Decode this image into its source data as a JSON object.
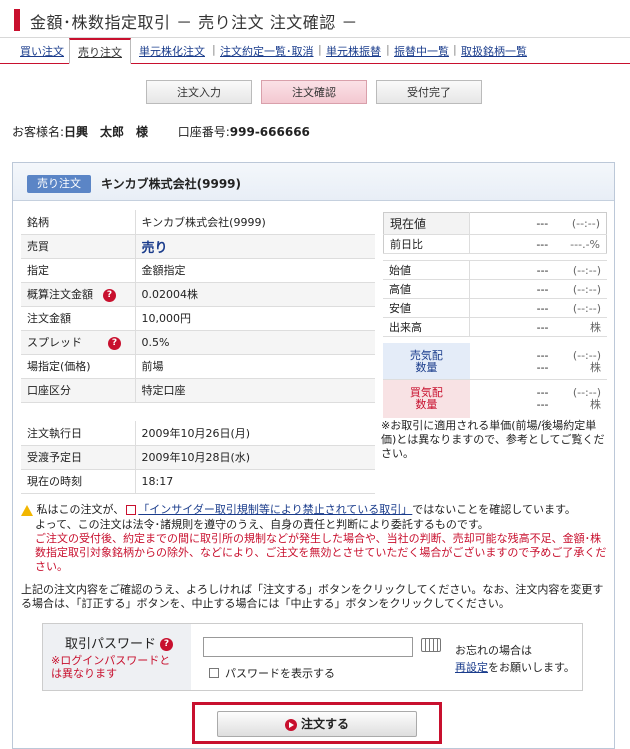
{
  "header": {
    "title": "金額･株数指定取引 － 売り注文 注文確認 －"
  },
  "tabs": [
    {
      "label": "買い注文"
    },
    {
      "label": "売り注文",
      "active": true
    },
    {
      "label": "単元株化注文"
    },
    {
      "label": "注文約定一覧･取消"
    },
    {
      "label": "単元株振替"
    },
    {
      "label": "振替中一覧"
    },
    {
      "label": "取扱銘柄一覧"
    }
  ],
  "steps": [
    {
      "label": "注文入力"
    },
    {
      "label": "注文確認",
      "active": true
    },
    {
      "label": "受付完了"
    }
  ],
  "customer": {
    "name_label": "お客様名:",
    "name": "日興　太郎　様",
    "account_label": "口座番号:",
    "account": "999-666666"
  },
  "panel": {
    "badge": "売り注文",
    "stock": "キンカブ株式会社(9999)"
  },
  "order_rows": [
    {
      "key": "銘柄",
      "value": "キンカブ株式会社(9999)"
    },
    {
      "key": "売買",
      "value": "売り"
    },
    {
      "key": "指定",
      "value": "金額指定"
    },
    {
      "key": "概算注文金額",
      "value": "0.02004株"
    },
    {
      "key": "注文金額",
      "value": "10,000円"
    },
    {
      "key": "スプレッド",
      "value": "0.5%"
    },
    {
      "key": "場指定(価格)",
      "value": "前場"
    },
    {
      "key": "口座区分",
      "value": "特定口座"
    }
  ],
  "date_rows": [
    {
      "key": "注文執行日",
      "value": "2009年10月26日(月)"
    },
    {
      "key": "受渡予定日",
      "value": "2009年10月28日(水)"
    },
    {
      "key": "現在の時刻",
      "value": "18:17"
    }
  ],
  "quote_top": [
    {
      "label": "現在値",
      "value": "---",
      "sub": "(--:--)"
    },
    {
      "label": "前日比",
      "value": "---",
      "sub": "---.-%"
    }
  ],
  "quote_ohlc": [
    {
      "label": "始値",
      "value": "---",
      "sub": "(--:--)"
    },
    {
      "label": "高値",
      "value": "---",
      "sub": "(--:--)"
    },
    {
      "label": "安値",
      "value": "---",
      "sub": "(--:--)"
    },
    {
      "label": "出来高",
      "value": "---",
      "sub": "株"
    }
  ],
  "ask": {
    "label1": "売気配",
    "label2": "数量",
    "value1": "---",
    "value2": "---",
    "sub1": "(--:--)",
    "sub2": "株"
  },
  "bid": {
    "label1": "買気配",
    "label2": "数量",
    "value1": "---",
    "value2": "---",
    "sub1": "(--:--)",
    "sub2": "株"
  },
  "quote_note": "※お取引に適用される単価(前場/後場約定単価)とは異なりますので、参考としてご覧ください。",
  "notice": {
    "line1_pre": "私はこの注文が、",
    "line1_link": "「インサイダー取引規制等により禁止されている取引」",
    "line1_post": "ではないことを確認しています。",
    "line2": "よって、この注文は法令･諸規則を遵守のうえ、自身の責任と判断により委託するものです。",
    "red": "ご注文の受付後、約定までの間に取引所の規制などが発生した場合や、当社の判断、売却可能な残高不足、金額･株数指定取引対象銘柄からの除外、などにより、ご注文を無効とさせていただく場合がございますので予めご了承ください。",
    "confirm": "上記の注文内容をご確認のうえ、よろしければ「注文する」ボタンをクリックしてください。なお、注文内容を変更する場合は、「訂正する」ボタンを、中止する場合には「中止する」ボタンをクリックしてください。"
  },
  "password": {
    "label": "取引パスワード",
    "sub": "※ログインパスワードとは異なります",
    "show_label": "パスワードを表示する",
    "forgot1": "お忘れの場合は",
    "forgot_link": "再設定",
    "forgot2": "をお願いします。"
  },
  "submit": {
    "label": "注文する"
  },
  "colors": {
    "accent": "#c8102e",
    "link": "#1a3c8c",
    "badge": "#5b85c6"
  }
}
